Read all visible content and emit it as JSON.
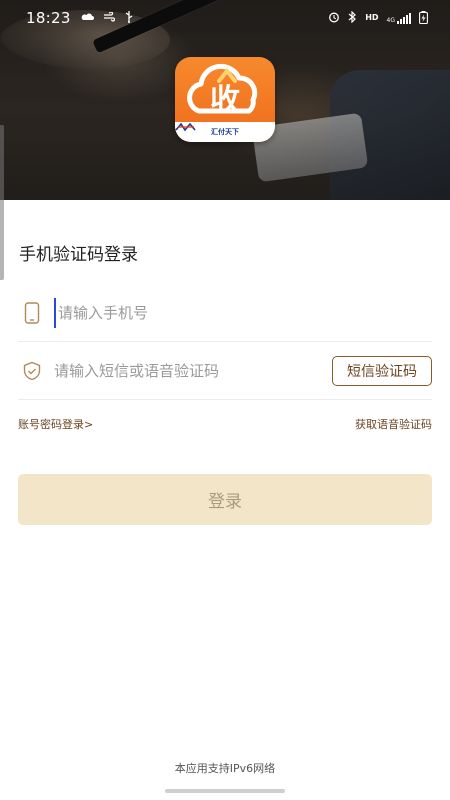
{
  "status_bar": {
    "time": "18:23",
    "left_icons": [
      "cloud-sun-icon",
      "wind-icon",
      "usb-icon"
    ],
    "right_icons": [
      "alarm-icon",
      "bluetooth-icon",
      "hd-icon",
      "signal-icon",
      "battery-icon"
    ],
    "hd_label": "HD",
    "network_label": "4G"
  },
  "logo": {
    "glyph": "收",
    "brand_text": "汇付天下"
  },
  "form": {
    "title": "手机验证码登录",
    "phone_placeholder": "请输入手机号",
    "code_placeholder": "请输入短信或语音验证码",
    "sms_button_label": "短信验证码",
    "password_login_link": "账号密码登录>",
    "voice_code_link": "获取语音验证码",
    "login_button_label": "登录"
  },
  "footer": {
    "note": "本应用支持IPv6网络"
  },
  "colors": {
    "accent_brown": "#6b4420",
    "login_button_bg": "#f3e6c8",
    "logo_orange": "#f47a24"
  }
}
